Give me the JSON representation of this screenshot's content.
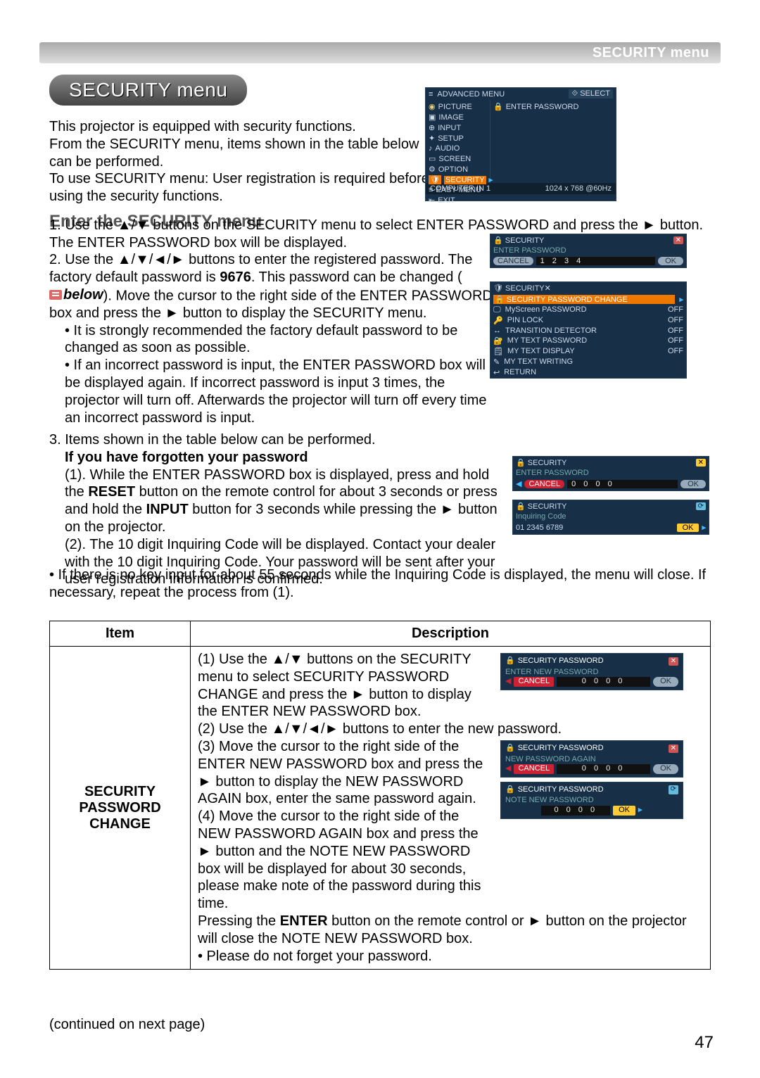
{
  "header": {
    "breadcrumb": "SECURITY menu"
  },
  "title": "SECURITY menu",
  "intro": {
    "p1": "This projector is equipped with security functions.",
    "p2": "From the SECURITY menu, items shown in the table below can be performed.",
    "p3": "To use SECURITY menu: User registration is required before using the security functions.",
    "h": "Enter the SECURITY menu"
  },
  "steps": {
    "s1": "1. Use the ▲/▼ buttons on the SECURITY menu to select ENTER PASSWORD and press the ► button. The ENTER PASSWORD box will be displayed.",
    "s2a": "2. Use the ▲/▼/◄/► buttons to enter the registered password. The factory default password is ",
    "s2b": "9676",
    "s2c": ". This password can be changed (",
    "s2ref": "below",
    "s2d": "). Move the cursor to the right side of the ENTER PASSWORD box and press the ► button to display the SECURITY menu.",
    "bullet1": "• It is strongly recommended the factory default password to be changed as soon as possible.",
    "bullet2": "• If an incorrect password is input, the ENTER PASSWORD box will be displayed again. If incorrect password is input 3 times, the projector will turn off. Afterwards the projector will turn off every time an incorrect password is input.",
    "s3": "3. Items shown in the table below can be performed."
  },
  "forgot": {
    "h": "If you have forgotten your password",
    "f1a": "(1). While the ENTER PASSWORD box is displayed, press and hold the ",
    "f1b": "RESET",
    "f1c": " button on the remote control for about 3 seconds or press and hold the ",
    "f1d": "INPUT",
    "f1e": " button for 3 seconds while pressing the ► button on the projector.",
    "f2": "(2). The 10 digit Inquiring Code will be displayed. Contact your dealer with the 10 digit Inquiring Code. Your password will be sent after your user registration information is confirmed.",
    "closing": "• If there is no key input for about 55 seconds while the Inquiring Code is displayed, the menu will close. If necessary, repeat the process from (1)."
  },
  "table": {
    "h_item": "Item",
    "h_desc": "Description",
    "item1": "SECURITY PASSWORD CHANGE",
    "desc1_1": "(1) Use the ▲/▼ buttons on the SECURITY menu to select SECURITY PASSWORD CHANGE and press the ► button to display the ENTER NEW PASSWORD box.",
    "desc1_2": "(2) Use the ▲/▼/◄/► buttons to enter the new password.",
    "desc1_3": "(3) Move the cursor to the right side of the ENTER NEW PASSWORD box and press the ► button to display the NEW PASSWORD AGAIN box, enter the same password again.",
    "desc1_4": "(4) Move the cursor to the right side of the NEW PASSWORD AGAIN box and press the ► button and the NOTE NEW PASSWORD box will be displayed for about 30 seconds, please make note of the password during this time.",
    "desc1_5a": "Pressing the ",
    "desc1_5b": "ENTER",
    "desc1_5c": " button on the remote control or ► button on the projector will close the NOTE NEW PASSWORD box.",
    "desc1_6": "• Please do not forget your password."
  },
  "osd_main": {
    "title": "ADVANCED MENU",
    "select": "SELECT",
    "items": [
      "PICTURE",
      "IMAGE",
      "INPUT",
      "SETUP",
      "AUDIO",
      "SCREEN",
      "OPTION",
      "SECURITY",
      "EASY MENU",
      "EXIT"
    ],
    "right": "ENTER PASSWORD",
    "foot_l": "COMPUTER IN 1",
    "foot_r": "1024 x 768 @60Hz"
  },
  "osd_enter": {
    "title": "SECURITY",
    "sub": "ENTER PASSWORD",
    "cancel": "CANCEL",
    "digits": "1 2 3 4",
    "ok": "OK"
  },
  "osd_secmenu": {
    "title": "SECURITY",
    "row0": "SECURITY PASSWORD CHANGE",
    "rows": [
      {
        "label": "MyScreen PASSWORD",
        "val": "OFF"
      },
      {
        "label": "PIN LOCK",
        "val": "OFF"
      },
      {
        "label": "TRANSITION DETECTOR",
        "val": "OFF"
      },
      {
        "label": "MY TEXT PASSWORD",
        "val": "OFF"
      },
      {
        "label": "MY TEXT DISPLAY",
        "val": "OFF"
      },
      {
        "label": "MY TEXT WRITING",
        "val": ""
      }
    ],
    "return": "RETURN"
  },
  "osd_forgot1": {
    "title": "SECURITY",
    "sub": "ENTER PASSWORD",
    "cancel": "CANCEL",
    "digits": "0 0 0 0",
    "ok": "OK"
  },
  "osd_forgot2": {
    "title": "SECURITY",
    "sub": "Inquiring Code",
    "code": "01 2345 6789",
    "ok": "OK"
  },
  "osd_desc1": {
    "title": "SECURITY PASSWORD",
    "sub": "ENTER NEW PASSWORD",
    "cancel": "CANCEL",
    "digits": "0 0 0 0",
    "ok": "OK"
  },
  "osd_desc2": {
    "title": "SECURITY PASSWORD",
    "sub": "NEW PASSWORD AGAIN",
    "cancel": "CANCEL",
    "digits": "0 0 0 0",
    "ok": "OK"
  },
  "osd_desc3": {
    "title": "SECURITY PASSWORD",
    "sub": "NOTE NEW PASSWORD",
    "digits": "0 0 0 0",
    "ok": "OK"
  },
  "footer": {
    "cont": "(continued on next page)",
    "page": "47"
  }
}
